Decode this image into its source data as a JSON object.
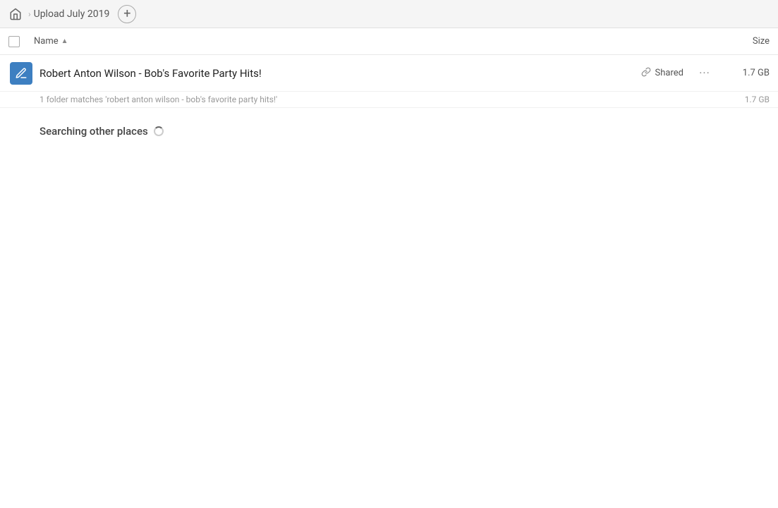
{
  "topbar": {
    "breadcrumb_label": "Upload July 2019",
    "add_button_label": "+"
  },
  "column_headers": {
    "name_label": "Name",
    "sort_indicator": "▲",
    "size_label": "Size"
  },
  "file_row": {
    "name": "Robert Anton Wilson - Bob's Favorite Party Hits!",
    "shared_label": "Shared",
    "more_label": "···",
    "size": "1.7 GB"
  },
  "match_hint": {
    "text": "1 folder matches 'robert anton wilson - bob's favorite party hits!'",
    "size": "1.7 GB"
  },
  "searching": {
    "label": "Searching other places"
  },
  "icons": {
    "home": "🏠",
    "chevron": "›",
    "link": "🔗",
    "folder_pencil": "✏️"
  }
}
